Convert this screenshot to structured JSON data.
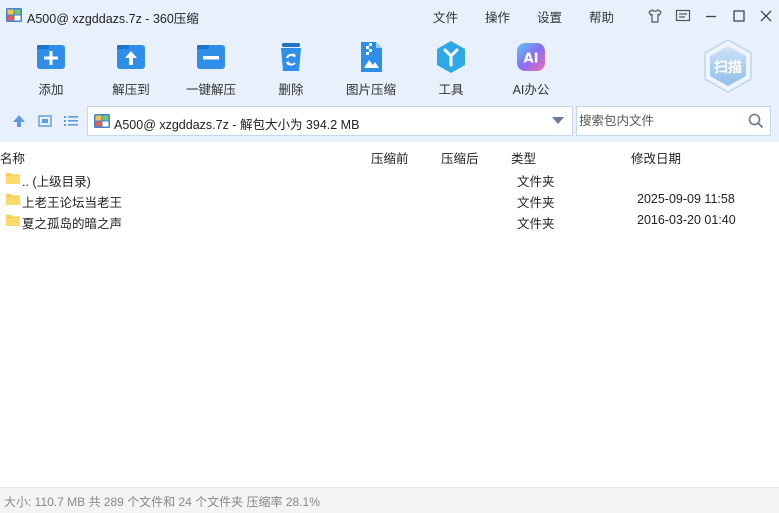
{
  "window": {
    "title": "A500@ xzgddazs.7z - 360压缩",
    "menu": [
      "文件",
      "操作",
      "设置",
      "帮助"
    ]
  },
  "toolbar": {
    "tools": [
      {
        "label": "添加",
        "icon": "add-icon"
      },
      {
        "label": "解压到",
        "icon": "extract-to-icon"
      },
      {
        "label": "一键解压",
        "icon": "one-click-extract-icon"
      },
      {
        "label": "删除",
        "icon": "recycle-bin-icon"
      },
      {
        "label": "图片压缩",
        "icon": "image-compress-icon"
      },
      {
        "label": "工具",
        "icon": "tools-icon"
      },
      {
        "label": "AI办公",
        "icon": "ai-office-icon"
      }
    ],
    "scan_label": "扫描"
  },
  "address": {
    "path": "A500@ xzgddazs.7z - 解包大小为 394.2 MB",
    "search_placeholder": "搜索包内文件"
  },
  "columns": {
    "name": "名称",
    "before": "压缩前",
    "after": "压缩后",
    "type": "类型",
    "modified": "修改日期"
  },
  "rows": [
    {
      "name": ".. (上级目录)",
      "type": "文件夹",
      "modified": ""
    },
    {
      "name": "上老王论坛当老王",
      "type": "文件夹",
      "modified": "2025-09-09 11:58"
    },
    {
      "name": "夏之孤岛的暗之声",
      "type": "文件夹",
      "modified": "2016-03-20 01:40"
    }
  ],
  "status": "大小: 110.7 MB 共 289 个文件和 24 个文件夹 压缩率 28.1%",
  "colors": {
    "chrome_bg": "#e7f0fb",
    "accent_blue": "#2f8fe8",
    "folder_yellow": "#f7cf55",
    "status_bg": "#f3f4f6"
  }
}
